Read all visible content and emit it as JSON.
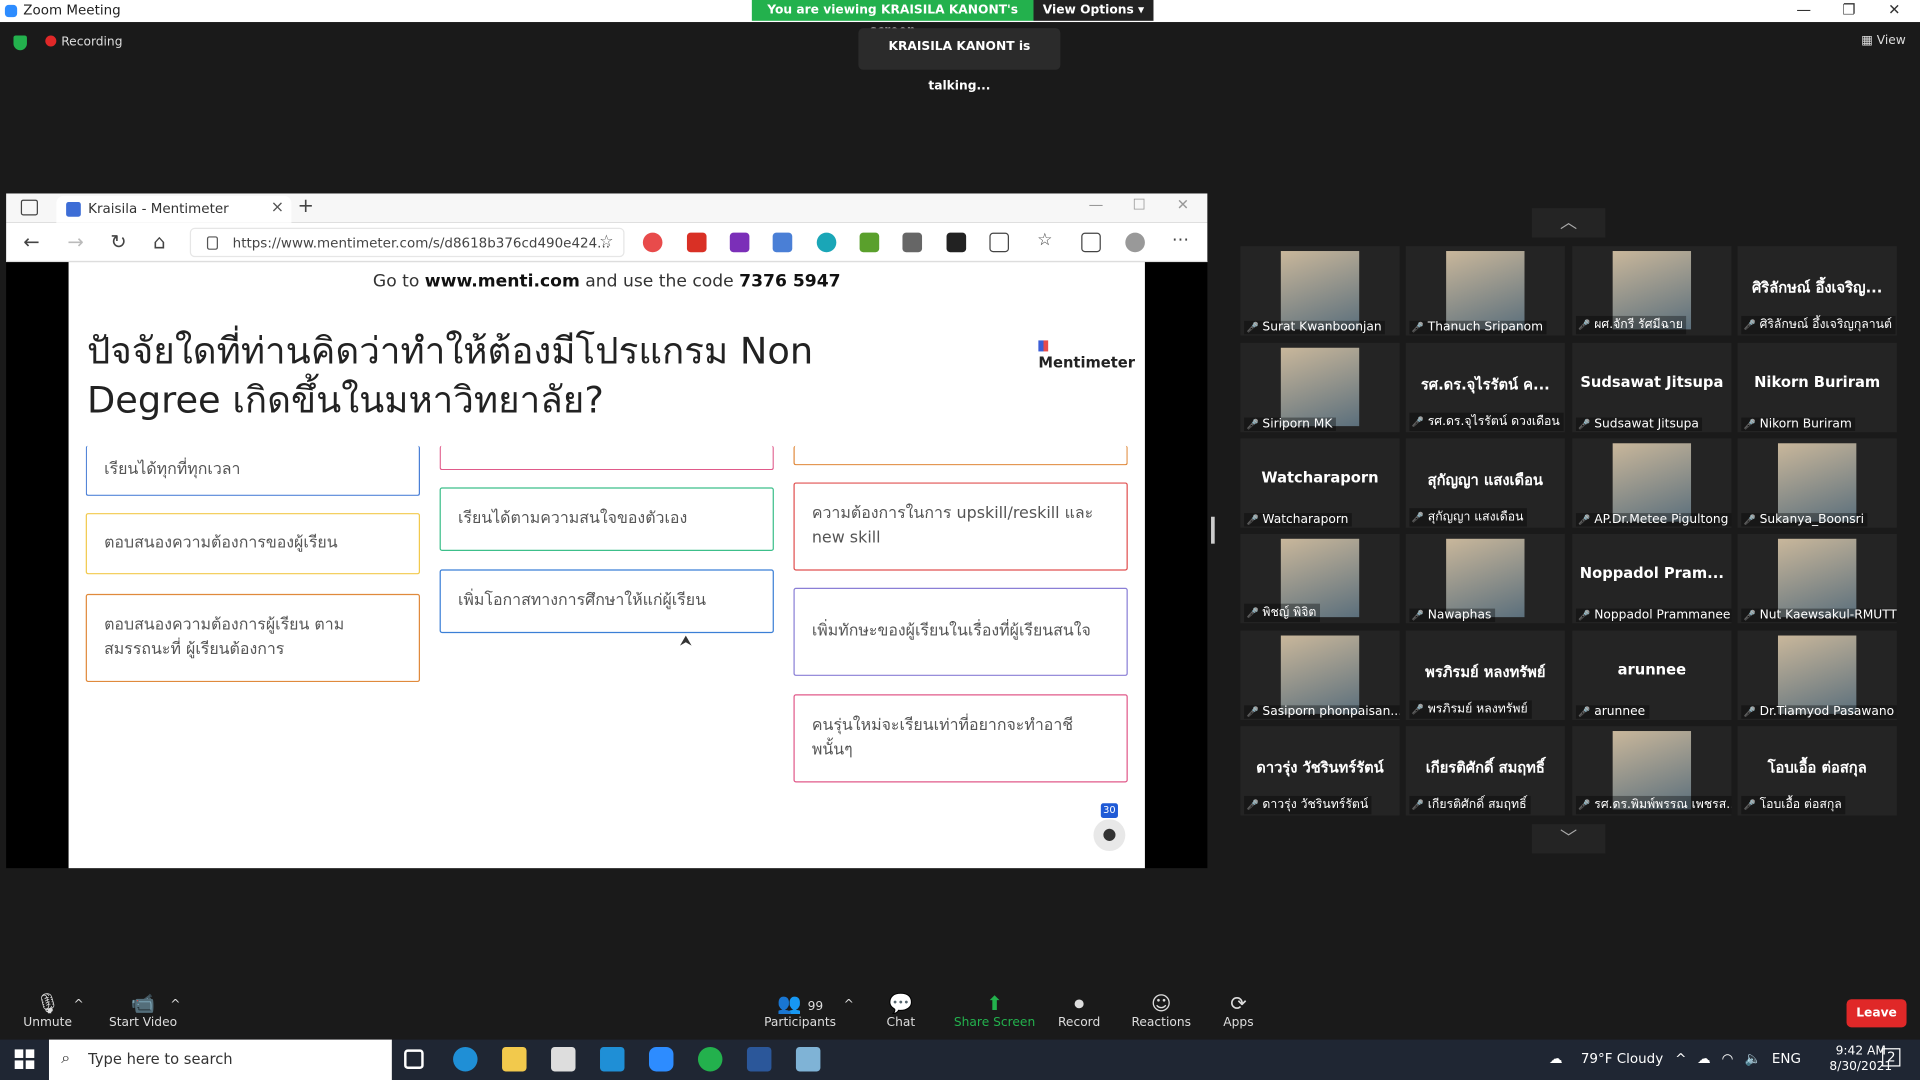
{
  "zoom": {
    "window_title": "Zoom Meeting",
    "share_banner": "You are viewing KRAISILA KANONT's screen",
    "view_options": "View Options",
    "recording": "Recording",
    "talking": "KRAISILA KANONT is talking...",
    "view_label": "View"
  },
  "browser": {
    "tab_title": "Kraisila - Mentimeter",
    "url": "https://www.mentimeter.com/s/d8618b376cd490e424..."
  },
  "slide": {
    "goto_prefix": "Go to",
    "goto_site": "www.menti.com",
    "goto_mid": "and use the code",
    "goto_code": "7376 5947",
    "title": "ปัจจัยใดที่ท่านคิดว่าทำให้ต้องมีโปรแกรม Non Degree เกิดขึ้นในมหาวิทยาลัย?",
    "brand": "Mentimeter",
    "responses": [
      "เรียนได้ทุกที่ทุกเวลา",
      "ตอบสนองความต้องการของผู้เรียน",
      "ตอบสนองความต้องการผู้เรียน ตามสมรรถนะที่ ผู้เรียนต้องการ",
      "เรียนได้ตามความสนใจของตัวเอง",
      "เพิ่มโอกาสทางการศึกษาให้แก่ผู้เรียน",
      "ความต้องการในการ upskill/reskill และ new skill",
      "เพิ่มทักษะของผู้เรียนในเรื่องที่ผู้เรียนสนใจ",
      "คนรุ่นใหม่จะเรียนเท่าที่อยากจะทำอาชีพนั้นๆ"
    ],
    "response_count": "30",
    "card_colors": [
      "#4a7fd6",
      "#f2c94c",
      "#e08a3c",
      "#3cbf8a",
      "#3b7fd6",
      "#e05050",
      "#8a7fd6",
      "#e05a8a"
    ]
  },
  "participants": [
    {
      "tile": "",
      "label": "Surat Kwanboonjan"
    },
    {
      "tile": "",
      "label": "Thanuch Sripanom"
    },
    {
      "tile": "",
      "label": "ผศ.จักรี รัศมีฉาย"
    },
    {
      "tile": "ศิริลักษณ์ อึ้งเจริญ...",
      "label": "ศิริลักษณ์ อึ้งเจริญกุลานต์"
    },
    {
      "tile": "",
      "label": "Siriporn MK"
    },
    {
      "tile": "รศ.ดร.จุไรรัตน์ ค...",
      "label": "รศ.ดร.จุไรรัตน์ ดวงเดือน"
    },
    {
      "tile": "Sudsawat Jitsupa",
      "label": "Sudsawat Jitsupa"
    },
    {
      "tile": "Nikorn Buriram",
      "label": "Nikorn Buriram"
    },
    {
      "tile": "Watcharaporn",
      "label": "Watcharaporn"
    },
    {
      "tile": "สุกัญญา แสงเดือน",
      "label": "สุกัญญา แสงเดือน"
    },
    {
      "tile": "",
      "label": "AP.Dr.Metee Pigultong"
    },
    {
      "tile": "",
      "label": "Sukanya_Boonsri"
    },
    {
      "tile": "",
      "label": "พิชญ์ พิจิต"
    },
    {
      "tile": "",
      "label": "Nawaphas"
    },
    {
      "tile": "Noppadol Pram...",
      "label": "Noppadol Prammanee"
    },
    {
      "tile": "",
      "label": "Nut Kaewsakul-RMUTT"
    },
    {
      "tile": "",
      "label": "Sasiporn phonpaisan..."
    },
    {
      "tile": "พรภิรมย์ หลงทรัพย์",
      "label": "พรภิรมย์ หลงทรัพย์"
    },
    {
      "tile": "arunnee",
      "label": "arunnee"
    },
    {
      "tile": "",
      "label": "Dr.Tiamyod Pasawano"
    },
    {
      "tile": "ดาวรุ่ง วัชรินทร์รัตน์",
      "label": "ดาวรุ่ง วัชรินทร์รัตน์"
    },
    {
      "tile": "เกียรติศักดิ์ สมฤทธิ์",
      "label": "เกียรติศักดิ์ สมฤทธิ์"
    },
    {
      "tile": "",
      "label": "รศ.ดร.พิมพ์พรรณ เพชรส..."
    },
    {
      "tile": "โอบเอื้อ ต่อสกุล",
      "label": "โอบเอื้อ ต่อสกุล"
    }
  ],
  "toolbar": {
    "unmute": "Unmute",
    "start_video": "Start Video",
    "participants_count": "99",
    "participants": "Participants",
    "chat": "Chat",
    "share_screen": "Share Screen",
    "record": "Record",
    "reactions": "Reactions",
    "apps": "Apps",
    "leave": "Leave"
  },
  "taskbar": {
    "search_placeholder": "Type here to search",
    "weather": "79°F  Cloudy",
    "lang": "ENG",
    "time": "9:42 AM",
    "date": "8/30/2021",
    "notif_count": "2"
  }
}
